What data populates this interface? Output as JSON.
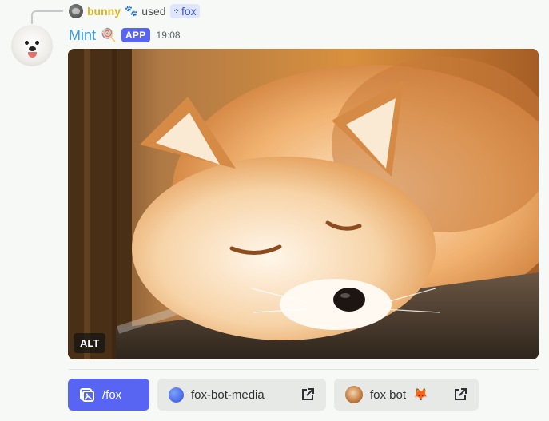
{
  "interaction": {
    "user": "bunny",
    "paw_icon": "🐾",
    "verb": "used",
    "command_chip": "fox"
  },
  "message": {
    "author": "Mint",
    "author_emoji": "🍭",
    "app_tag": "APP",
    "timestamp": "19:08",
    "image_alt_badge": "ALT"
  },
  "buttons": [
    {
      "label": "/fox",
      "icon": "image-gallery-icon",
      "style": "primary"
    },
    {
      "label": "fox-bot-media",
      "icon": "globe-icon",
      "trailing_icon": "external-link-icon",
      "style": "secondary"
    },
    {
      "label": "fox bot",
      "emoji": "🦊",
      "icon": "bot-avatar",
      "trailing_icon": "external-link-icon",
      "style": "secondary"
    }
  ],
  "colors": {
    "accent": "#5865f2",
    "author": "#3a9ce0",
    "reply_user": "#d5b52a",
    "background": "#f7f9f6"
  }
}
